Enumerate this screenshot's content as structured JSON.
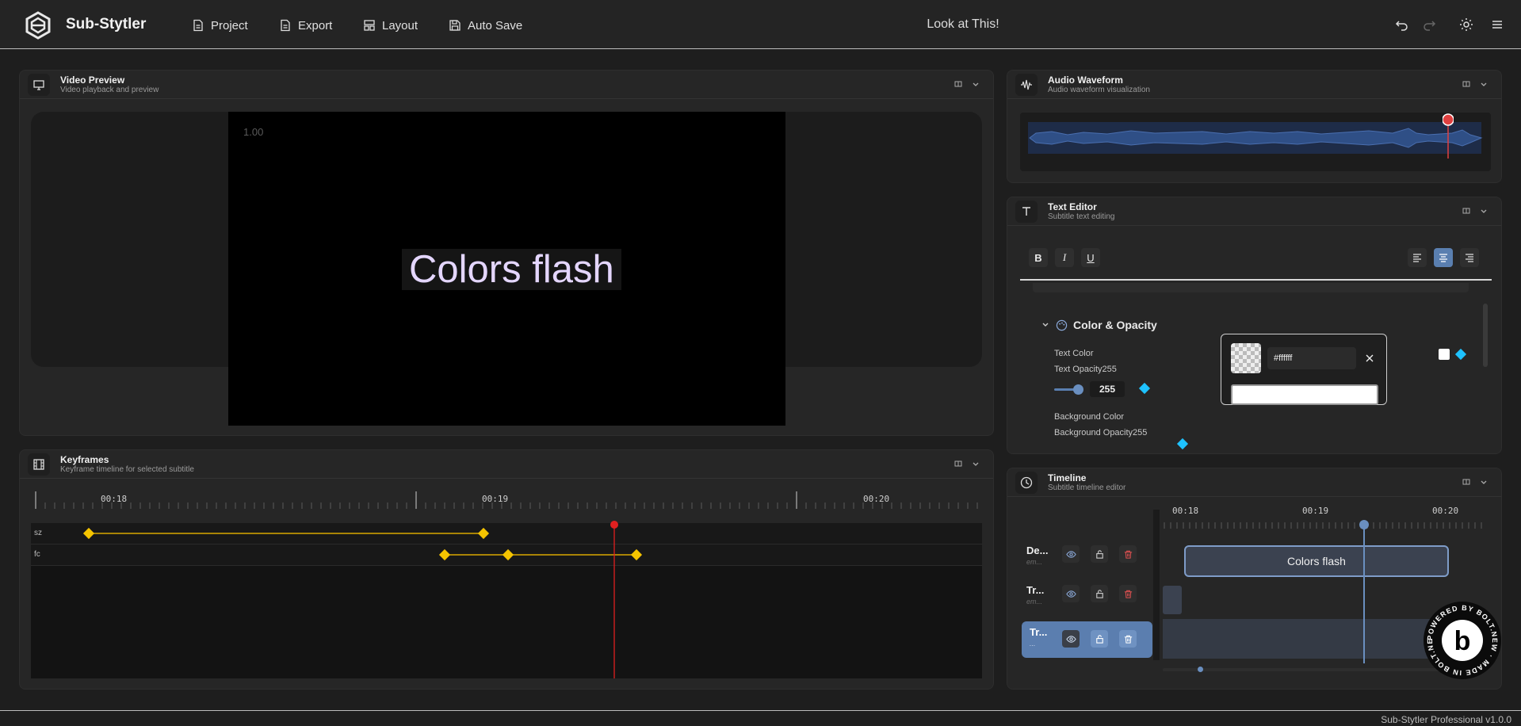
{
  "app": {
    "name": "Sub-Stytler",
    "document_title": "Look at This!",
    "footer": "Sub-Stytler Professional v1.0.0"
  },
  "nav": [
    {
      "label": "Project",
      "icon": "document-icon"
    },
    {
      "label": "Export",
      "icon": "document-icon"
    },
    {
      "label": "Layout",
      "icon": "layout-icon"
    },
    {
      "label": "Auto Save",
      "icon": "save-icon"
    }
  ],
  "video_preview": {
    "title": "Video Preview",
    "subtitle": "Video playback and preview",
    "playback_rate": "1.00",
    "subtitle_text": "Colors flash",
    "subtitle_color": "#e4d6ff"
  },
  "keyframes": {
    "title": "Keyframes",
    "subtitle": "Keyframe timeline for selected subtitle",
    "ruler_labels": [
      "00:18",
      "00:19",
      "00:20"
    ],
    "tracks": [
      {
        "label": "sz"
      },
      {
        "label": "fc"
      }
    ],
    "keyframe_color": "#f5c400",
    "playhead_color": "#e02020"
  },
  "audio_waveform": {
    "title": "Audio Waveform",
    "subtitle": "Audio waveform visualization",
    "playhead_position": 0.93
  },
  "text_editor": {
    "title": "Text Editor",
    "subtitle": "Subtitle text editing",
    "format_buttons": [
      "B",
      "I",
      "U"
    ],
    "section_title": "Color & Opacity",
    "text_color_label": "Text Color",
    "text_opacity_label": "Text Opacity255",
    "text_opacity_value": "255",
    "background_color_label": "Background Color",
    "background_opacity_label": "Background Opacity255",
    "hex_value": "#ffffff",
    "accent_color": "#1ec2ff"
  },
  "timeline": {
    "title": "Timeline",
    "subtitle": "Subtitle timeline editor",
    "ruler_labels": [
      "00:18",
      "00:19",
      "00:20"
    ],
    "tracks": [
      {
        "name": "De...",
        "meta": "em..."
      },
      {
        "name": "Tr...",
        "meta": "em..."
      },
      {
        "name": "Tr...",
        "meta": "..."
      }
    ],
    "clip_label": "Colors flash"
  },
  "badge": {
    "ring_text": "POWERED BY BOLT.NEW · MADE IN BOLT.NEW ·",
    "letter": "b"
  }
}
